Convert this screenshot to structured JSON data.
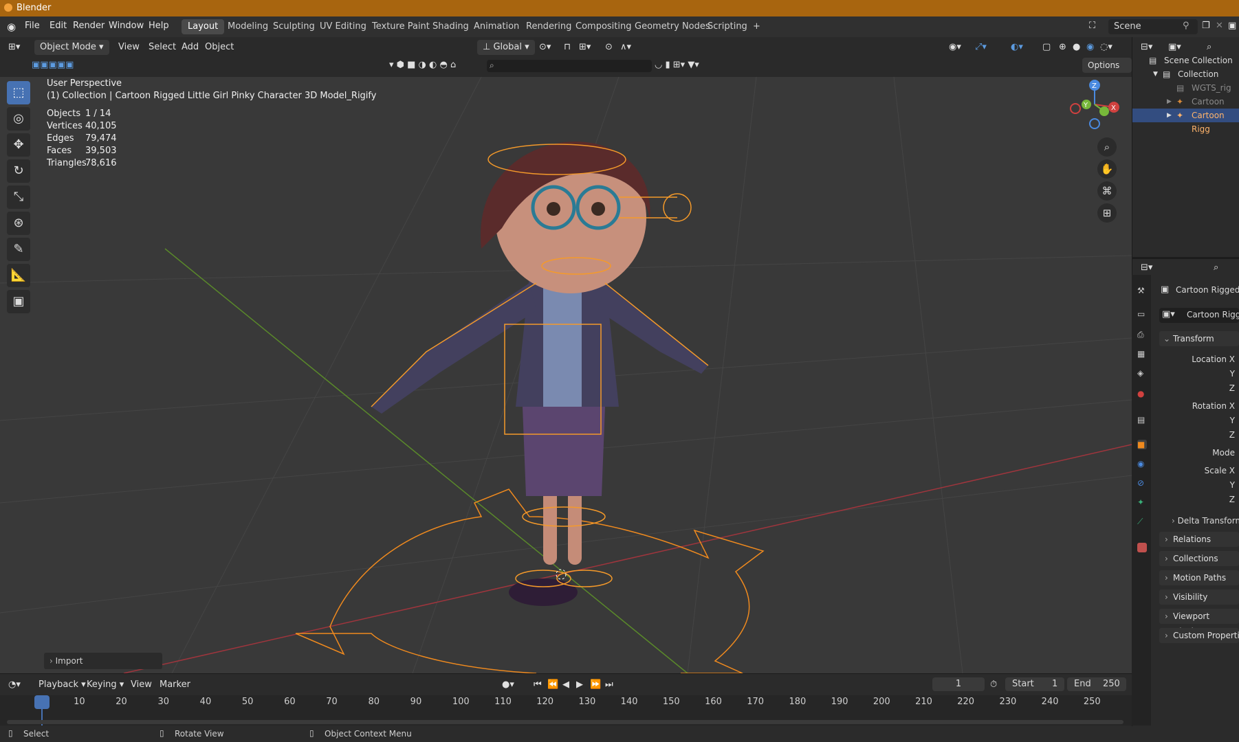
{
  "window": {
    "title": "Blender"
  },
  "menu": [
    "File",
    "Edit",
    "Render",
    "Window",
    "Help"
  ],
  "workspaces": [
    "Layout",
    "Modeling",
    "Sculpting",
    "UV Editing",
    "Texture Paint",
    "Shading",
    "Animation",
    "Rendering",
    "Compositing",
    "Geometry Nodes",
    "Scripting",
    "+"
  ],
  "scene": {
    "name": "Scene"
  },
  "viewport_header": {
    "mode": "Object Mode",
    "menus": [
      "View",
      "Select",
      "Add",
      "Object"
    ],
    "orientation": "Global",
    "options": "Options"
  },
  "overlay": {
    "perspective": "User Perspective",
    "collection": "(1) Collection | Cartoon Rigged Little Girl Pinky Character 3D Model_Rigify",
    "stats": [
      {
        "label": "Objects",
        "value": "1 / 14"
      },
      {
        "label": "Vertices",
        "value": "40,105"
      },
      {
        "label": "Edges",
        "value": "79,474"
      },
      {
        "label": "Faces",
        "value": "39,503"
      },
      {
        "label": "Triangles",
        "value": "78,616"
      }
    ]
  },
  "gizmo": {
    "x": "X",
    "y": "Y",
    "z": "Z"
  },
  "import_panel": "Import",
  "timeline": {
    "menus": [
      "Playback",
      "Keying",
      "View",
      "Marker"
    ],
    "current_frame": "1",
    "start_label": "Start",
    "start": "1",
    "end_label": "End",
    "end": "250",
    "ruler": [
      "1",
      "10",
      "20",
      "30",
      "40",
      "50",
      "60",
      "70",
      "80",
      "90",
      "100",
      "110",
      "120",
      "130",
      "140",
      "150",
      "160",
      "170",
      "180",
      "190",
      "200",
      "210",
      "220",
      "230",
      "240",
      "250"
    ]
  },
  "statusbar": {
    "select": "Select",
    "rotate": "Rotate View",
    "context": "Object Context Menu"
  },
  "outliner": {
    "rows": [
      {
        "label": "Scene Collection"
      },
      {
        "label": "Collection"
      },
      {
        "label": "WGTS_rig"
      },
      {
        "label": "Cartoon Rigg"
      },
      {
        "label": "Cartoon Rigg"
      }
    ]
  },
  "properties": {
    "object_name": "Cartoon Rigged Li",
    "data_name": "Cartoon Rigged",
    "transform_label": "Transform",
    "location_x": "Location X",
    "rotation_x": "Rotation X",
    "mode": "Mode",
    "scale_x": "Scale X",
    "y": "Y",
    "z": "Z",
    "delta": "Delta Transform",
    "sections": [
      "Relations",
      "Collections",
      "Motion Paths",
      "Visibility",
      "Viewport Display",
      "Custom Properties"
    ]
  }
}
